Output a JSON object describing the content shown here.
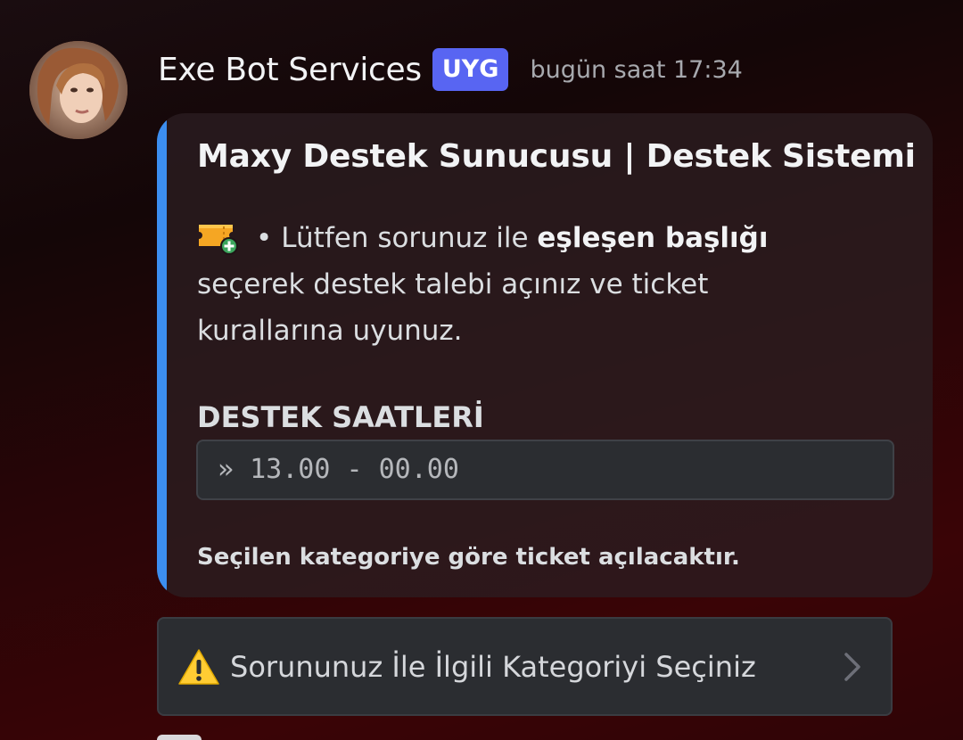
{
  "message": {
    "author": {
      "username": "Exe Bot Services",
      "badge": "UYG",
      "avatar_icon": "user-avatar-photo"
    },
    "timestamp": "bugün saat 17:34",
    "embed": {
      "accent_color": "#3c8ef0",
      "title": "Maxy Destek Sunucusu | Destek Sistemi",
      "description": {
        "icon": "ticket-add-icon",
        "bullet": "•",
        "text_before": "Lütfen sorunuz ile ",
        "bold_text": "eşleşen başlığı",
        "text_after": " seçerek destek talebi açınız ve ticket kurallarına uyunuz."
      },
      "field": {
        "name": "DESTEK SAATLERİ",
        "value": "» 13.00 - 00.00"
      },
      "footer": "Seçilen kategoriye göre ticket açılacaktır."
    },
    "select_menu": {
      "icon": "warning-icon",
      "placeholder": "Sorununuz İle İlgili Kategoriyi Seçiniz",
      "chevron": "chevron-right-icon"
    }
  },
  "colors": {
    "badge_bg": "#5865f2",
    "embed_bg": "#2b1e21",
    "code_bg": "#2b2d31"
  }
}
